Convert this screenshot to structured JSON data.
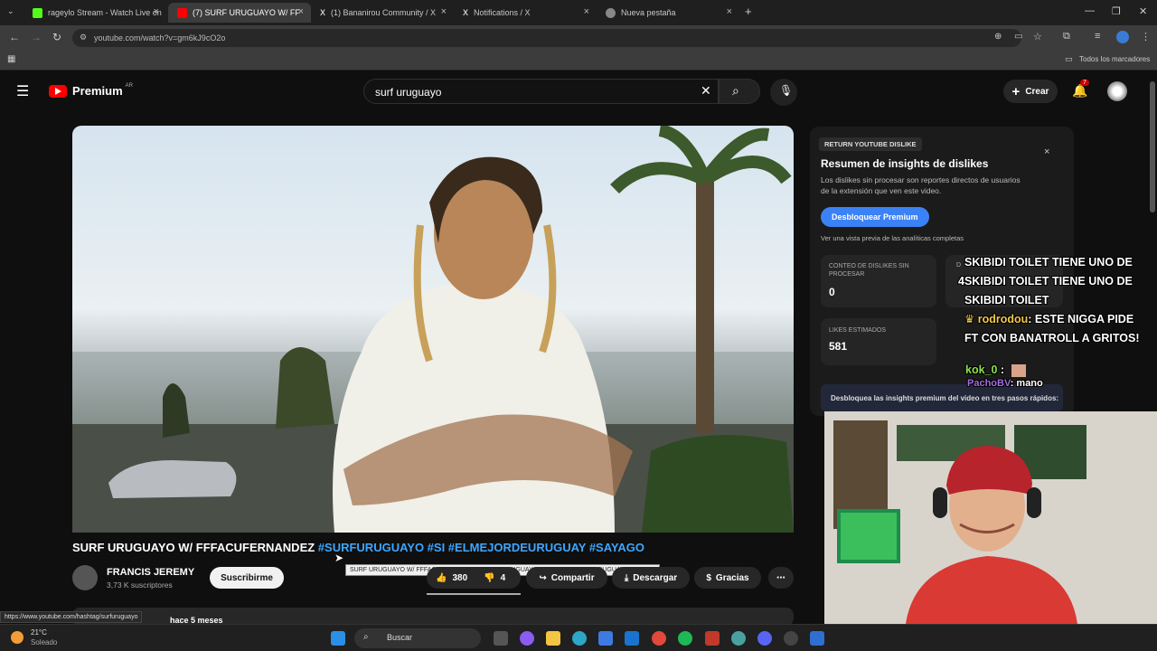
{
  "browser": {
    "tabs": [
      {
        "label": "rageylo Stream - Watch Live on",
        "color": "#53fc18"
      },
      {
        "label": "(7) SURF URUGUAYO W/ FF",
        "color": "#ff0000"
      },
      {
        "label": "(1) Bananirou Community / X",
        "color": "#ffffff"
      },
      {
        "label": "Notifications / X",
        "color": "#ffffff"
      },
      {
        "label": "Nueva pestaña",
        "color": "#aaaaaa"
      }
    ],
    "url": "youtube.com/watch?v=gm6kJ9cO2o",
    "bookmarks_label": "Todos los marcadores"
  },
  "youtube": {
    "brand": "Premium",
    "region": "AR",
    "search_value": "surf uruguayo",
    "create_label": "Crear",
    "notif_count": "7"
  },
  "video": {
    "title_main": "SURF URUGUAYO W/ FFFACUFERNANDEZ ",
    "title_tags": "#SURFURUGUAYO #SI #ELMEJORDEURUGUAY #SAYAGO",
    "tooltip": "SURF URUGUAYO W/ FFFACUFERNANDEZ #SURFURUGUAYO #SI #ELMEJORDEURUGUAY #SAYAGO",
    "channel": "FRANCIS JEREMY",
    "subs": "3,73 K suscriptores",
    "subscribe": "Suscribirme",
    "likes": "380",
    "dislikes": "4",
    "share": "Compartir",
    "download": "Descargar",
    "thanks": "Gracias",
    "posted": "hace 5 meses"
  },
  "ryd": {
    "badge": "RETURN YOUTUBE DISLIKE",
    "title": "Resumen de insights de dislikes",
    "desc": "Los dislikes sin procesar son reportes directos de usuarios de la extensión que ven este video.",
    "button": "Desbloquear Premium",
    "preview": "Ver una vista previa de las analíticas completas",
    "stat1_label": "CONTEO DE DISLIKES SIN PROCESAR",
    "stat1_value": "0",
    "stat2_label": "D",
    "stat3_label": "LIKES ESTIMADOS",
    "stat3_value": "581",
    "unlock": "Desbloquea las insights premium del video en tres pasos rápidos:"
  },
  "chat": {
    "line1": "SKIBIDI TOILET TIENE UNO DE",
    "line2": "4SKIBIDI TOILET TIENE UNO DE",
    "line3": "SKIBIDI TOILET",
    "user1": "rodrodou",
    "msg1": ": ESTE NIGGA PIDE",
    "msg1b": "FT CON BANATROLL A GRITOS!",
    "user2": "kok_0",
    "msg2": " :",
    "user3": "PachoBV",
    "msg3": ": mano"
  },
  "status_link": "https://www.youtube.com/hashtag/surfuruguayo",
  "taskbar": {
    "temp": "21°C",
    "weather": "Soleado",
    "search": "Buscar"
  }
}
